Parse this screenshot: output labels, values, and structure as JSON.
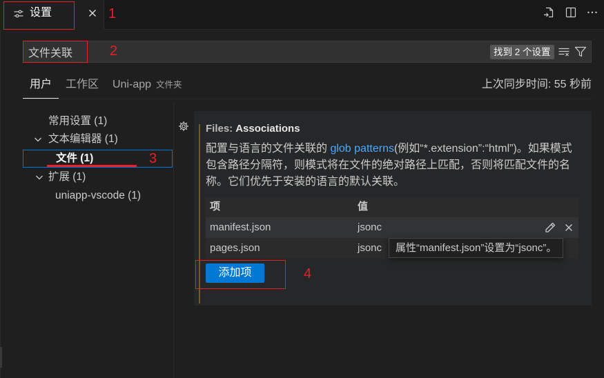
{
  "editor_tab": {
    "icon": "settings-sliders-icon",
    "title": "设置",
    "close_icon": "close-icon"
  },
  "editor_actions": [
    "open-settings-json-icon",
    "split-editor-icon",
    "more-actions-icon"
  ],
  "search": {
    "value": "文件关联",
    "result_badge": "找到 2 个设置",
    "clear_icon": "clear-filter-icon",
    "filter_icon": "filter-icon"
  },
  "scope_tabs": [
    {
      "label": "用户",
      "active": true
    },
    {
      "label": "工作区",
      "active": false
    },
    {
      "label": "Uni-app",
      "suffix": "文件夹",
      "active": false
    }
  ],
  "sync_status": "上次同步时间: 55 秒前",
  "toc": [
    {
      "label": "常用设置 (1)"
    },
    {
      "label": "文本编辑器 (1)",
      "expanded": true
    },
    {
      "label": "文件 (1)",
      "selected": true
    },
    {
      "label": "扩展 (1)",
      "expanded": true
    },
    {
      "label": "uniapp-vscode (1)"
    }
  ],
  "setting": {
    "category": "Files:",
    "name": "Associations",
    "description": {
      "before_link": "配置与语言的文件关联的 ",
      "link": "glob patterns",
      "after_link": "(例如“*.extension”:“html”)。如果模式包含路径分隔符，则模式将在文件的绝对路径上匹配，否则将匹配文件的名称。它们优先于安装的语言的默认关联。"
    },
    "table": {
      "headers": {
        "key": "项",
        "value": "值"
      },
      "rows": [
        {
          "key": "manifest.json",
          "value": "jsonc",
          "hovered": true
        },
        {
          "key": "pages.json",
          "value": "jsonc",
          "hovered": false
        }
      ]
    },
    "tooltip": "属性“manifest.json”设置为“jsonc”。",
    "add_button": "添加项"
  },
  "annotations": {
    "tab": "1",
    "search": "2",
    "toc": "3",
    "button": "4"
  },
  "colors": {
    "background": "#1f1f1f",
    "accent": "#0078d4",
    "annotation": "#e8202a",
    "link": "#4daafc"
  }
}
